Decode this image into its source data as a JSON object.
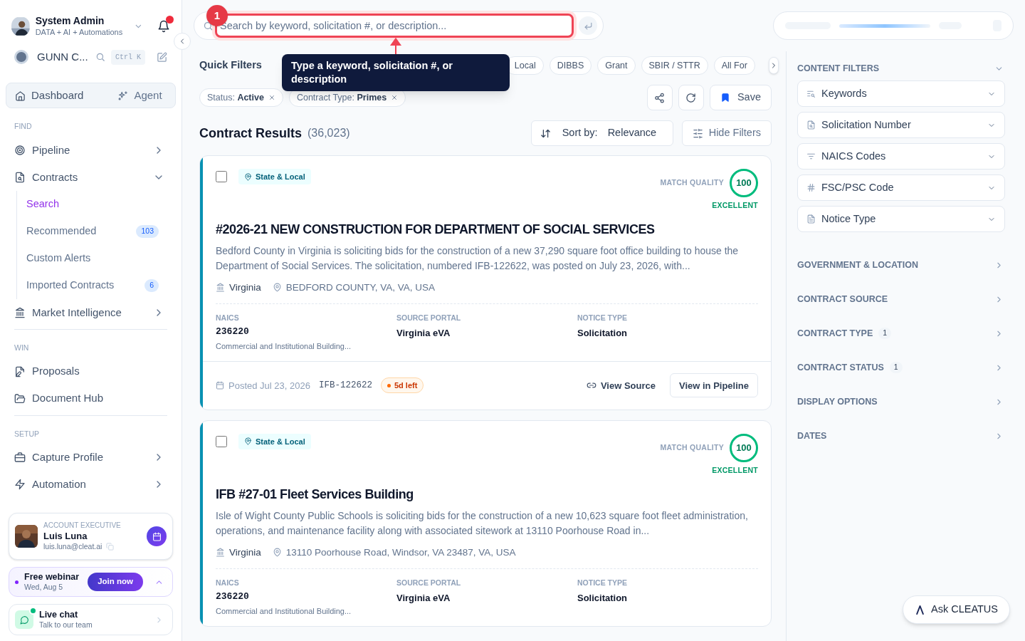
{
  "sidebar": {
    "user": {
      "name": "System Admin",
      "subtitle": "DATA + AI + Automations",
      "notification": true
    },
    "org": {
      "name": "GUNN C...",
      "shortcut": "Ctrl K"
    },
    "top_nav": [
      {
        "label": "Dashboard",
        "selected": true
      },
      {
        "label": "Agent",
        "selected": false
      }
    ],
    "sections": [
      {
        "heading": "FIND",
        "items": [
          {
            "label": "Pipeline",
            "expanded": false
          },
          {
            "label": "Contracts",
            "expanded": true,
            "children": [
              {
                "label": "Search",
                "selected": true
              },
              {
                "label": "Recommended",
                "selected": false,
                "badge": "103"
              },
              {
                "label": "Custom Alerts",
                "selected": false
              },
              {
                "label": "Imported Contracts",
                "selected": false,
                "badge": "6"
              }
            ]
          },
          {
            "label": "Market Intelligence",
            "expanded": false
          }
        ]
      },
      {
        "heading": "WIN",
        "items": [
          {
            "label": "Proposals"
          },
          {
            "label": "Document Hub"
          }
        ]
      },
      {
        "heading": "SETUP",
        "items": [
          {
            "label": "Capture Profile",
            "expanded": false
          },
          {
            "label": "Automation",
            "expanded": false
          }
        ]
      }
    ],
    "account": {
      "role": "ACCOUNT EXECUTIVE",
      "name": "Luis Luna",
      "email": "luis.luna@cleat.ai"
    },
    "webinar": {
      "title": "Free webinar",
      "date": "Wed, Aug 5",
      "button": "Join now",
      "expanded": true
    },
    "chat": {
      "title": "Live chat",
      "subtitle": "Talk to our team",
      "online": true
    }
  },
  "search": {
    "placeholder": "Search by keyword, solicitation #, or description...",
    "step": "1",
    "tooltip": "Type a keyword, solicitation #, or description"
  },
  "quick_filters": {
    "label": "Quick Filters",
    "chips": [
      "Local",
      "DIBBS",
      "Grant",
      "SBIR / STTR",
      "All For"
    ]
  },
  "active_filters": [
    {
      "name": "Status:",
      "value": "Active"
    },
    {
      "name": "Contract Type:",
      "value": "Primes"
    }
  ],
  "toolbar": {
    "save": "Save"
  },
  "results": {
    "title": "Contract Results",
    "count": "(36,023)",
    "sort_label": "Sort by:",
    "sort_value": "Relevance",
    "hide_filters": "Hide Filters"
  },
  "cards": [
    {
      "selected": false,
      "tag": "State & Local",
      "match_label": "MATCH QUALITY",
      "score": "100",
      "rating": "EXCELLENT",
      "title": "#2026-21 NEW CONSTRUCTION FOR DEPARTMENT OF SOCIAL SERVICES",
      "description": "Bedford County in Virginia is soliciting bids for the construction of a new 37,290 square foot office building to house the Department of Social Services. The solicitation, numbered IFB-122622, was posted on July 23, 2026, with...",
      "agency": "Virginia",
      "location": "BEDFORD COUNTY, VA, VA, USA",
      "fields": [
        {
          "label": "NAICS",
          "value": "236220",
          "note": "Commercial and Institutional Building..."
        },
        {
          "label": "SOURCE PORTAL",
          "value": "Virginia eVA"
        },
        {
          "label": "NOTICE TYPE",
          "value": "Solicitation"
        }
      ],
      "footer": {
        "posted": "Posted Jul 23, 2026",
        "number": "IFB-122622",
        "deadline": "5d left",
        "source": "View Source",
        "pipeline": "View in Pipeline"
      }
    },
    {
      "selected": false,
      "tag": "State & Local",
      "match_label": "MATCH QUALITY",
      "score": "100",
      "rating": "EXCELLENT",
      "title": "IFB #27-01 Fleet Services Building",
      "description": "Isle of Wight County Public Schools is soliciting bids for the construction of a new 10,623 square foot fleet administration, operations, and maintenance facility along with associated sitework at 13110 Poorhouse Road in...",
      "agency": "Virginia",
      "location": "13110 Poorhouse Road, Windsor, VA 23487, VA, USA",
      "fields": [
        {
          "label": "NAICS",
          "value": "236220",
          "note": "Commercial and Institutional Building..."
        },
        {
          "label": "SOURCE PORTAL",
          "value": "Virginia eVA"
        },
        {
          "label": "NOTICE TYPE",
          "value": "Solicitation"
        }
      ]
    }
  ],
  "filters_panel": {
    "heading": "CONTENT FILTERS",
    "expanded": true,
    "filters": [
      "Keywords",
      "Solicitation Number",
      "NAICS Codes",
      "FSC/PSC Code",
      "Notice Type"
    ],
    "sections": [
      {
        "label": "GOVERNMENT & LOCATION"
      },
      {
        "label": "CONTRACT SOURCE"
      },
      {
        "label": "CONTRACT TYPE",
        "count": "1"
      },
      {
        "label": "CONTRACT STATUS",
        "count": "1"
      },
      {
        "label": "DISPLAY OPTIONS"
      },
      {
        "label": "DATES"
      }
    ]
  },
  "assistant": {
    "label": "Ask CLEATUS"
  }
}
